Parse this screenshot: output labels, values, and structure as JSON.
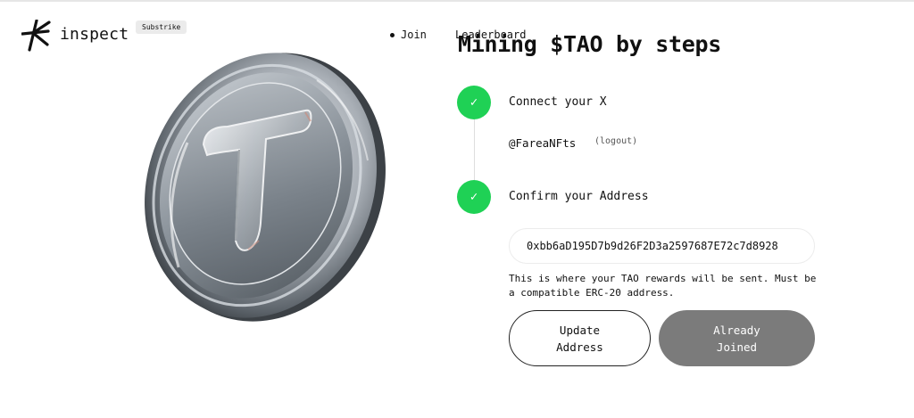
{
  "header": {
    "logo_text": "inspect",
    "badge": "Substrike",
    "nav": {
      "join": "Join",
      "leaderboard": "Leaderboard"
    }
  },
  "main": {
    "title": "Mining $TAO by steps",
    "steps": [
      {
        "label": "Connect your X",
        "status_icon": "check-icon",
        "status": "complete"
      },
      {
        "label": "Confirm your Address",
        "status_icon": "check-icon",
        "status": "complete"
      }
    ],
    "check_glyph": "✓",
    "twitter_handle": "@FareaNFts",
    "logout_label": "(logout)",
    "address_value": "0xbb6aD195D7b9d26F2D3a2597687E72c7d8928",
    "helper_text": "This is where your TAO rewards will be sent. Must be a compatible ERC-20 address.",
    "buttons": {
      "update": "Update Address",
      "joined": "Already Joined"
    }
  },
  "colors": {
    "accent_green": "#1fd155",
    "disabled_button": "#7b7b7b",
    "text": "#111111"
  }
}
